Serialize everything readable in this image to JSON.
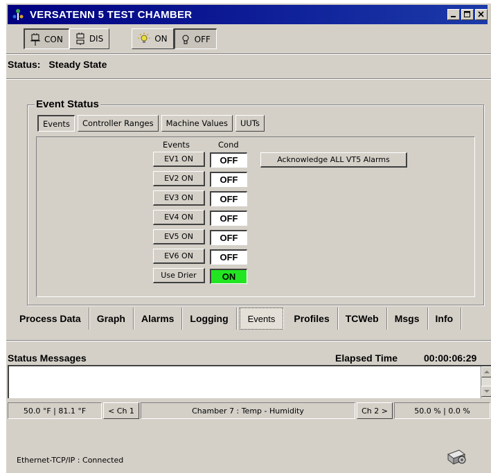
{
  "window": {
    "title": "VERSATENN 5 TEST CHAMBER"
  },
  "toolbar": {
    "con_label": "CON",
    "dis_label": "DIS",
    "light_on_label": "ON",
    "light_off_label": "OFF"
  },
  "status": {
    "label": "Status:",
    "value": "Steady State"
  },
  "event_status": {
    "title": "Event Status",
    "subtabs": [
      "Events",
      "Controller Ranges",
      "Machine Values",
      "UUTs"
    ],
    "active_subtab": "Events",
    "col_events": "Events",
    "col_cond": "Cond",
    "rows": [
      {
        "button": "EV1 ON",
        "cond": "OFF"
      },
      {
        "button": "EV2 ON",
        "cond": "OFF"
      },
      {
        "button": "EV3 ON",
        "cond": "OFF"
      },
      {
        "button": "EV4 ON",
        "cond": "OFF"
      },
      {
        "button": "EV5 ON",
        "cond": "OFF"
      },
      {
        "button": "EV6 ON",
        "cond": "OFF"
      },
      {
        "button": "Use Drier",
        "cond": "ON"
      }
    ],
    "acknowledge_button": "Acknowledge ALL VT5 Alarms",
    "cond_on_color": "#22e522"
  },
  "main_tabs": [
    "Process Data",
    "Graph",
    "Alarms",
    "Logging",
    "Events",
    "Profiles",
    "TCWeb",
    "Msgs",
    "Info"
  ],
  "active_main_tab": "Events",
  "status_messages": {
    "title": "Status Messages",
    "elapsed_label": "Elapsed Time",
    "elapsed_value": "00:00:06:29"
  },
  "statusbar": {
    "ch1_temps": "50.0 °F  |  81.1 °F",
    "ch1_button": "< Ch 1",
    "chamber": "Chamber 7 : Temp - Humidity",
    "ch2_button": "Ch 2 >",
    "ch2_values": "50.0 %  |  0.0 %"
  },
  "connection": {
    "text": "Ethernet-TCP/IP : Connected"
  },
  "colors": {
    "title_bar": "#000080",
    "face": "#d4d0c8"
  }
}
